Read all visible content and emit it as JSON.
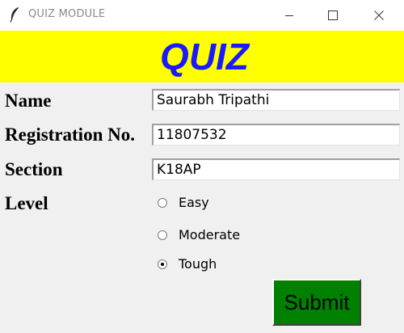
{
  "window": {
    "title": "QUIZ MODULE",
    "app_icon": "feather-icon",
    "controls": {
      "minimize_icon": "minimize-icon",
      "maximize_icon": "maximize-icon",
      "close_icon": "close-icon"
    }
  },
  "header": {
    "title": "QUIZ",
    "background_color": "#ffff00",
    "text_color": "#1a1aff"
  },
  "form": {
    "fields": [
      {
        "label": "Name",
        "value": "Saurabh Tripathi"
      },
      {
        "label": "Registration No.",
        "value": "11807532"
      },
      {
        "label": "Section",
        "value": "K18AP"
      }
    ],
    "level": {
      "label": "Level",
      "options": [
        {
          "label": "Easy",
          "selected": false
        },
        {
          "label": "Moderate",
          "selected": false
        },
        {
          "label": "Tough",
          "selected": true
        }
      ],
      "selected": "Tough"
    },
    "submit": {
      "label": "Submit",
      "background_color": "#008000"
    }
  }
}
